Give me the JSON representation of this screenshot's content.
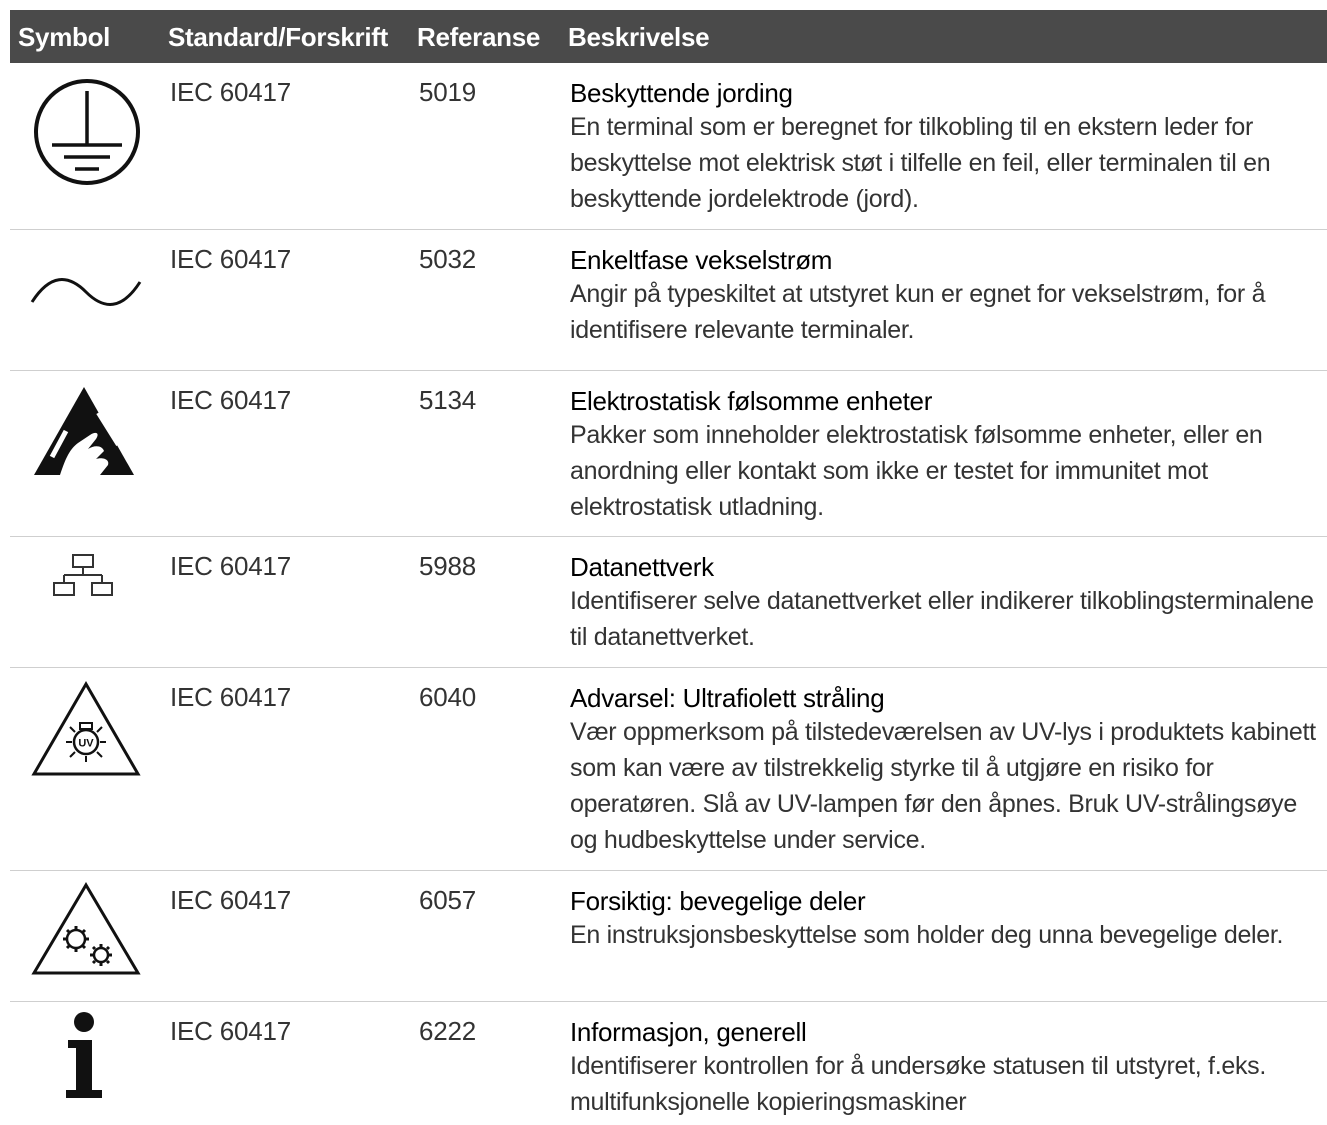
{
  "header": {
    "symbol": "Symbol",
    "standard": "Standard/Forskrift",
    "reference": "Referanse",
    "description": "Beskrivelse"
  },
  "rows": [
    {
      "icon": "protective-earth-icon",
      "standard": "IEC 60417",
      "reference": "5019",
      "title": "Beskyttende jording",
      "body": "En terminal som er beregnet for tilkobling til en ekstern leder for beskyttelse mot elektrisk støt i tilfelle en feil, eller terminalen til en beskyttende jordelektrode (jord)."
    },
    {
      "icon": "alternating-current-icon",
      "standard": "IEC 60417",
      "reference": "5032",
      "title": "Enkeltfase vekselstrøm",
      "body": "Angir på typeskiltet at utstyret kun er egnet for vekselstrøm, for å identifisere relevante terminaler."
    },
    {
      "icon": "electrostatic-sensitive-icon",
      "standard": "IEC 60417",
      "reference": "5134",
      "title": "Elektrostatisk følsomme enheter",
      "body": "Pakker som inneholder elektrostatisk følsomme enheter, eller en anordning eller kontakt som ikke er testet for immunitet mot elektrostatisk utladning."
    },
    {
      "icon": "data-network-icon",
      "standard": "IEC 60417",
      "reference": "5988",
      "title": "Datanettverk",
      "body": "Identifiserer selve datanettverket eller indikerer tilkoblingsterminalene til datanettverket."
    },
    {
      "icon": "uv-radiation-warning-icon",
      "standard": "IEC 60417",
      "reference": "6040",
      "title": "Advarsel: Ultrafiolett stråling",
      "body": "Vær oppmerksom på tilstedeværelsen av UV-lys i produktets kabinett som kan være av tilstrekkelig styrke til å utgjøre en risiko for operatøren. Slå av UV-lampen før den åpnes. Bruk UV-strålingsøye og hudbeskyttelse under service.",
      "icon_text": "UV"
    },
    {
      "icon": "moving-parts-warning-icon",
      "standard": "IEC 60417",
      "reference": "6057",
      "title": "Forsiktig: bevegelige deler",
      "body": "En instruksjonsbeskyttelse som holder deg unna bevegelige deler."
    },
    {
      "icon": "information-icon",
      "standard": "IEC 60417",
      "reference": "6222",
      "title": "Informasjon, generell",
      "body": "Identifiserer kontrollen for å undersøke statusen til utstyret, f.eks. multifunksjonelle kopieringsmaskiner"
    }
  ]
}
